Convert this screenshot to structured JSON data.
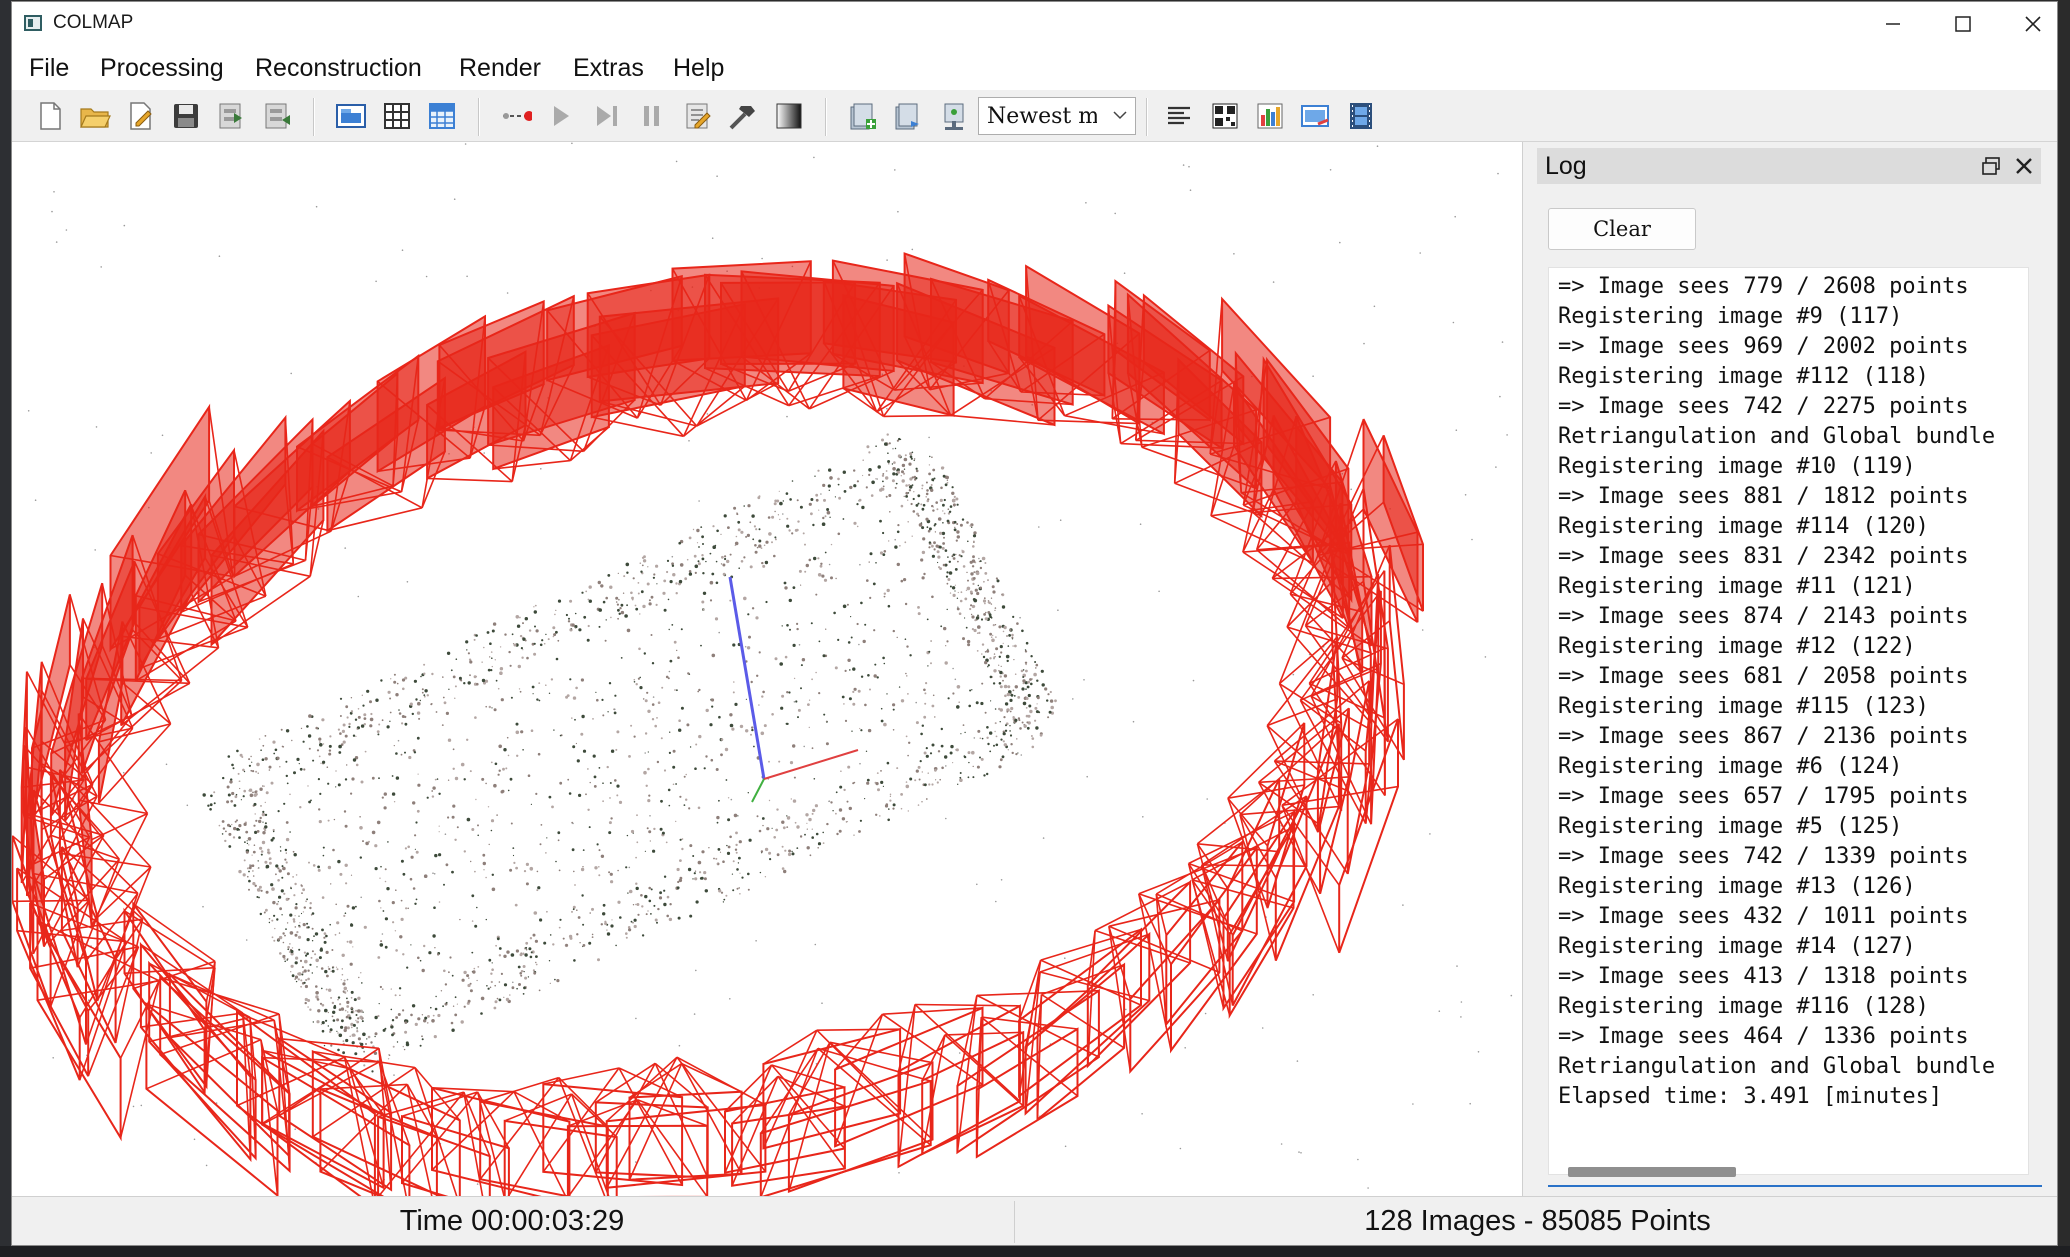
{
  "window": {
    "title": "COLMAP"
  },
  "menu": [
    "File",
    "Processing",
    "Reconstruction",
    "Render",
    "Extras",
    "Help"
  ],
  "toolbar": {
    "icons": [
      "new-project-icon",
      "open-project-icon",
      "edit-project-icon",
      "save-project-icon",
      "import-model-icon",
      "export-model-icon",
      "feature-extraction-icon",
      "feature-matching-icon",
      "database-management-icon",
      "start-reconstruction-icon",
      "step-reconstruction-icon",
      "pause-reconstruction-icon",
      "reconstruction-options-icon",
      "bundle-adjustment-icon",
      "dense-reconstruction-icon",
      "add-model-icon",
      "model-stats-icon",
      "grab-image-icon"
    ],
    "combo_value": "Newest model",
    "right_icons": [
      "show-log-icon",
      "match-matrix-icon",
      "reconstruction-stats-icon",
      "grab-movie-icon",
      "movie-icon"
    ]
  },
  "log": {
    "title": "Log",
    "clear_label": "Clear",
    "lines": [
      "=> Image sees 779 / 2608 points",
      "Registering image #9 (117)",
      "=> Image sees 969 / 2002 points",
      "Registering image #112 (118)",
      "=> Image sees 742 / 2275 points",
      "Retriangulation and Global bundle",
      "Registering image #10 (119)",
      "=> Image sees 881 / 1812 points",
      "Registering image #114 (120)",
      "=> Image sees 831 / 2342 points",
      "Registering image #11 (121)",
      "=> Image sees 874 / 2143 points",
      "Registering image #12 (122)",
      "=> Image sees 681 / 2058 points",
      "Registering image #115 (123)",
      "=> Image sees 867 / 2136 points",
      "Registering image #6 (124)",
      "=> Image sees 657 / 1795 points",
      "Registering image #5 (125)",
      "=> Image sees 742 / 1339 points",
      "Registering image #13 (126)",
      "=> Image sees 432 / 1011 points",
      "Registering image #14 (127)",
      "=> Image sees 413 / 1318 points",
      "Registering image #116 (128)",
      "=> Image sees 464 / 1336 points",
      "Retriangulation and Global bundle",
      "Elapsed time: 3.491 [minutes]"
    ]
  },
  "status": {
    "time": "Time 00:00:03:29",
    "counts": "128 Images - 85085 Points"
  },
  "colors": {
    "camera_red": "#e8261a",
    "axis_blue": "#5b5be8",
    "axis_red": "#e04040",
    "axis_green": "#40b040"
  }
}
